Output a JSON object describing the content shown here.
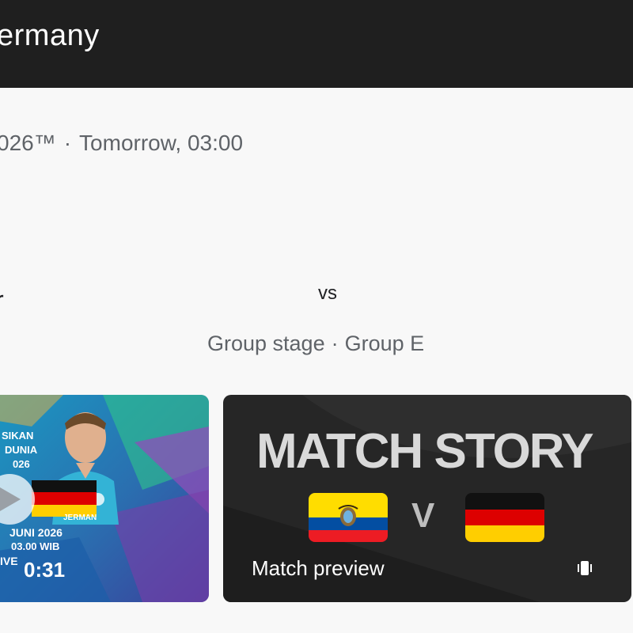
{
  "header": {
    "title": "ermany"
  },
  "match": {
    "competition": "026™",
    "separator": "·",
    "time": "Tomorrow, 03:00",
    "team_left": "r",
    "vs": "vs",
    "stage": "Group stage",
    "group": "Group E"
  },
  "videos": [
    {
      "duration": "0:31",
      "thumb_lines": [
        "SIKAN",
        "DUNIA",
        "026",
        "JERMAN",
        "JUNI 2026",
        "03.00 WIB",
        "IVE"
      ],
      "icon": "play-icon"
    },
    {
      "title": "MATCH STORY",
      "v": "V",
      "label": "Match preview",
      "icon": "shorts-icon"
    }
  ],
  "colors": {
    "header_bg": "#1f1f1f",
    "ger_black": "#111111",
    "ger_red": "#dd0000",
    "ger_gold": "#ffce00",
    "ecu_yellow": "#ffdd00",
    "ecu_blue": "#034ea2",
    "ecu_red": "#ed1c24"
  }
}
